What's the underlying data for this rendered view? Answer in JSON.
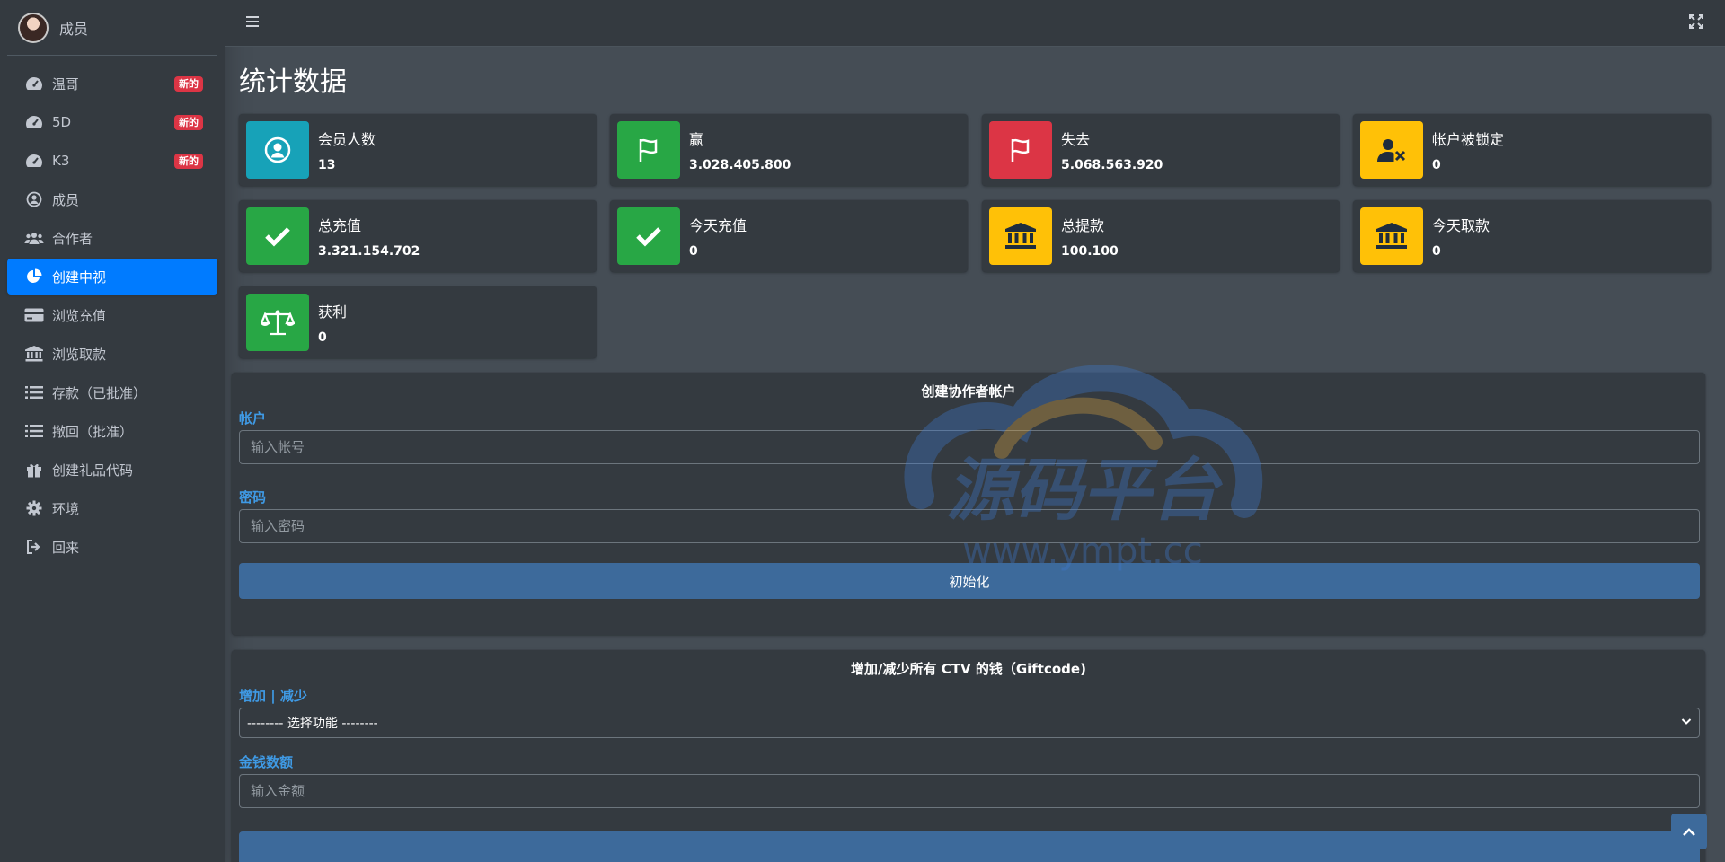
{
  "sidebar": {
    "user_name": "成员",
    "items": [
      {
        "label": "温哥",
        "badge": "新的",
        "icon": "tachometer-icon"
      },
      {
        "label": "5D",
        "badge": "新的",
        "icon": "tachometer-icon"
      },
      {
        "label": "K3",
        "badge": "新的",
        "icon": "tachometer-icon"
      },
      {
        "label": "成员",
        "icon": "user-circle-icon"
      },
      {
        "label": "合作者",
        "icon": "users-icon"
      },
      {
        "label": "创建中视",
        "icon": "pie-chart-icon",
        "active": true
      },
      {
        "label": "浏览充值",
        "icon": "credit-card-icon"
      },
      {
        "label": "浏览取款",
        "icon": "bank-icon"
      },
      {
        "label": "存款（已批准）",
        "icon": "list-icon"
      },
      {
        "label": "撤回（批准）",
        "icon": "list-icon"
      },
      {
        "label": "创建礼品代码",
        "icon": "gift-icon"
      },
      {
        "label": "环境",
        "icon": "gear-icon"
      },
      {
        "label": "回来",
        "icon": "sign-out-icon"
      }
    ]
  },
  "page": {
    "title": "统计数据"
  },
  "stats": [
    {
      "label": "会员人数",
      "value": "13",
      "color": "#17a2b8",
      "icon": "user-icon"
    },
    {
      "label": "赢",
      "value": "3.028.405.800",
      "color": "#28a745",
      "icon": "flag-icon"
    },
    {
      "label": "失去",
      "value": "5.068.563.920",
      "color": "#dc3545",
      "icon": "flag-icon"
    },
    {
      "label": "帐户被锁定",
      "value": "0",
      "color": "#ffc107",
      "icon": "user-x-icon"
    },
    {
      "label": "总充值",
      "value": "3.321.154.702",
      "color": "#28a745",
      "icon": "check-icon"
    },
    {
      "label": "今天充值",
      "value": "0",
      "color": "#28a745",
      "icon": "check-icon"
    },
    {
      "label": "总提款",
      "value": "100.100",
      "color": "#ffc107",
      "icon": "bank-icon"
    },
    {
      "label": "今天取款",
      "value": "0",
      "color": "#ffc107",
      "icon": "bank-icon"
    },
    {
      "label": "获利",
      "value": "0",
      "color": "#28a745",
      "icon": "balance-scale-icon"
    }
  ],
  "form_ctv": {
    "title": "创建协作者帐户",
    "account_label": "帐户",
    "account_placeholder": "输入帐号",
    "password_label": "密码",
    "password_placeholder": "输入密码",
    "submit_label": "初始化"
  },
  "form_money": {
    "title": "增加/减少所有 CTV 的钱（Giftcode)",
    "mode_label": "增加 | 减少",
    "mode_selected": "-------- 选择功能 --------",
    "amount_label": "金钱数额",
    "amount_placeholder": "输入金额"
  },
  "watermark": {
    "main": "源码平台",
    "url": "www.ympt.cc"
  }
}
